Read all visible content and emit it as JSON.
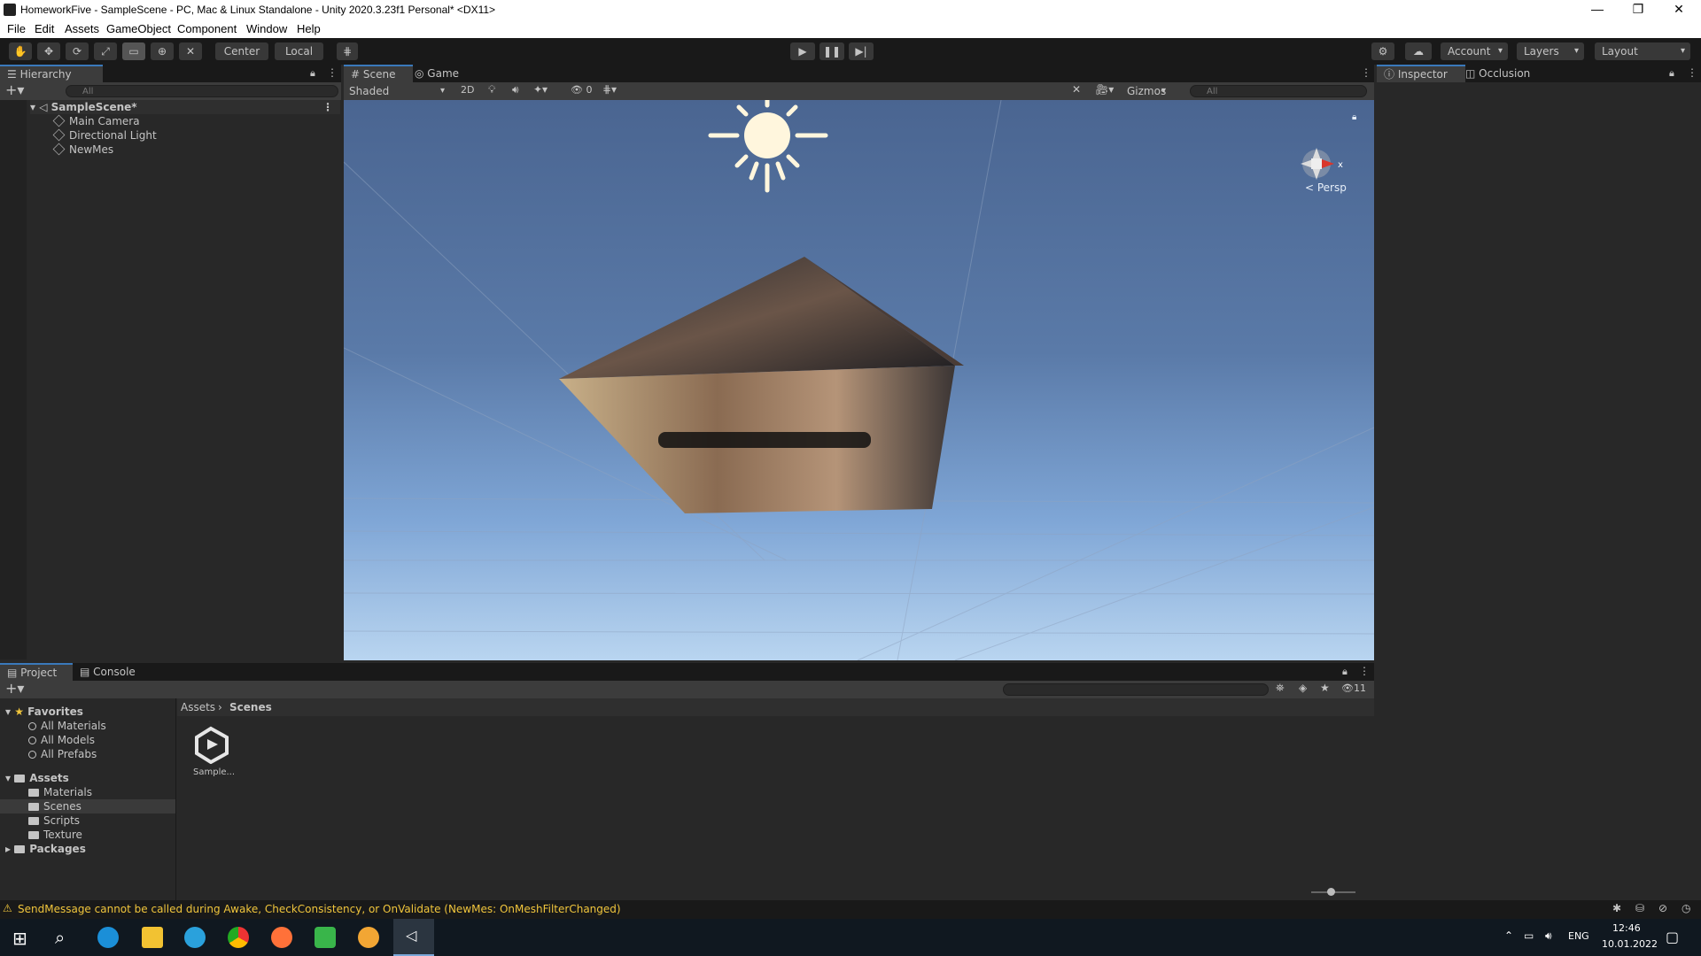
{
  "window": {
    "title": "HomeworkFive - SampleScene - PC, Mac & Linux Standalone - Unity 2020.3.23f1 Personal* <DX11>",
    "minimize": "—",
    "maximize": "❐",
    "close": "✕"
  },
  "menu": [
    "File",
    "Edit",
    "Assets",
    "GameObject",
    "Component",
    "Window",
    "Help"
  ],
  "toolbar": {
    "pivot_label": "Center",
    "space_label": "Local",
    "account_label": "Account",
    "layers_label": "Layers",
    "layout_label": "Layout"
  },
  "hierarchy": {
    "tab_label": "Hierarchy",
    "search_placeholder": "All",
    "scene_name": "SampleScene*",
    "items": [
      "Main Camera",
      "Directional Light",
      "NewMes"
    ]
  },
  "scene": {
    "tabs": [
      "Scene",
      "Game"
    ],
    "shading_mode": "Shaded",
    "mode_2d": "2D",
    "hidden_count": "0",
    "gizmos_label": "Gizmos",
    "search_placeholder": "All",
    "persp_label": "< Persp",
    "axis_x": "x"
  },
  "inspector": {
    "tabs": [
      "Inspector",
      "Occlusion"
    ]
  },
  "project": {
    "tabs": [
      "Project",
      "Console"
    ],
    "hidden_count": "11",
    "favorites_label": "Favorites",
    "favorites": [
      "All Materials",
      "All Models",
      "All Prefabs"
    ],
    "assets_label": "Assets",
    "asset_folders": [
      "Materials",
      "Scenes",
      "Scripts",
      "Texture"
    ],
    "packages_label": "Packages",
    "breadcrumb": [
      "Assets",
      "Scenes"
    ],
    "files": [
      "Sample..."
    ]
  },
  "status": {
    "message": "SendMessage cannot be called during Awake, CheckConsistency, or OnValidate (NewMes: OnMeshFilterChanged)"
  },
  "taskbar": {
    "language": "ENG",
    "time": "12:46",
    "date": "10.01.2022"
  },
  "colors": {
    "accent": "#3a79bb",
    "warning": "#f0c53c",
    "panel_bg": "#282828",
    "toolbar_bg": "#191919"
  }
}
